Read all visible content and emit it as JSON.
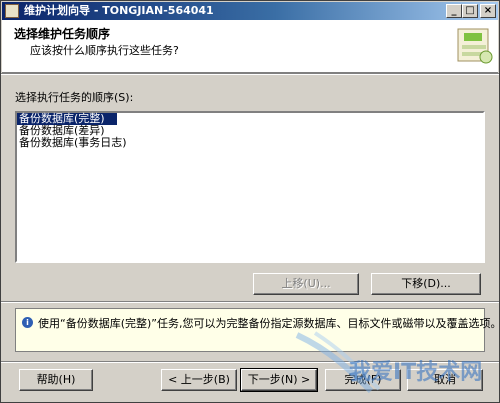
{
  "window": {
    "title": "维护计划向导 - TONGJIAN-564041",
    "buttons": {
      "minimize": "_",
      "maximize": "□",
      "close": "×"
    }
  },
  "header": {
    "title": "选择维护任务顺序",
    "subtitle": "应该按什么顺序执行这些任务?"
  },
  "task_order": {
    "label": "选择执行任务的顺序(S):",
    "items": [
      {
        "label": "备份数据库(完整)",
        "selected": true
      },
      {
        "label": "备份数据库(差异)",
        "selected": false
      },
      {
        "label": "备份数据库(事务日志)",
        "selected": false
      }
    ],
    "move_up_label": "上移(U)...",
    "move_down_label": "下移(D)..."
  },
  "info": {
    "icon": "info-icon",
    "text": "使用“备份数据库(完整)”任务,您可以为完整备份指定源数据库、目标文件或磁带以及覆盖选项。"
  },
  "footer": {
    "help_label": "帮助(H)",
    "back_label": "< 上一步(B)",
    "next_label": "下一步(N) >",
    "finish_label": "完成(F)",
    "cancel_label": "取消"
  },
  "watermark": {
    "text": "我爱IT技术网"
  },
  "colors": {
    "titlebar_start": "#0a246a",
    "titlebar_end": "#a6caf0",
    "dialog_bg": "#d4d0c8",
    "selection": "#0a246a",
    "info_bg": "#ffffe8"
  }
}
